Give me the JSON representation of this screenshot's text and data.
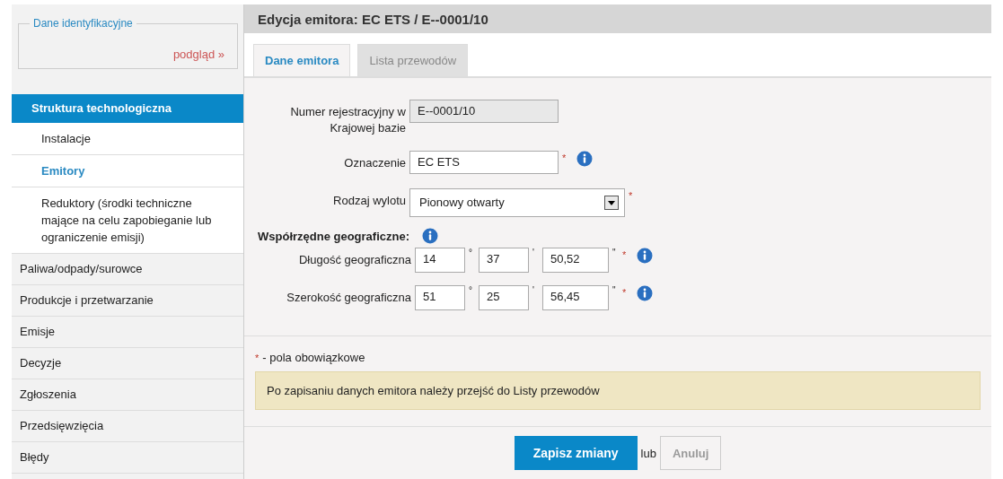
{
  "sidebar": {
    "id_panel": {
      "legend": "Dane identyfikacyjne",
      "link": "podgląd »"
    },
    "items": [
      {
        "label": "Struktura technologiczna",
        "selected": true,
        "children": [
          {
            "label": "Instalacje",
            "selected": false
          },
          {
            "label": "Emitory",
            "selected": true
          },
          {
            "label": "Reduktory (środki techniczne mające na celu zapobieganie lub ograniczenie emisji)",
            "selected": false
          }
        ]
      },
      {
        "label": "Paliwa/odpady/surowce",
        "selected": false
      },
      {
        "label": "Produkcje i przetwarzanie",
        "selected": false
      },
      {
        "label": "Emisje",
        "selected": false
      },
      {
        "label": "Decyzje",
        "selected": false
      },
      {
        "label": "Zgłoszenia",
        "selected": false
      },
      {
        "label": "Przedsięwzięcia",
        "selected": false
      },
      {
        "label": "Błędy",
        "selected": false
      }
    ]
  },
  "header": {
    "title": "Edycja emitora: EC ETS / E--0001/10"
  },
  "tabs": [
    {
      "label": "Dane emitora",
      "selected": true
    },
    {
      "label": "Lista przewodów",
      "selected": false
    }
  ],
  "form": {
    "fields": [
      {
        "kind": "readonly",
        "label": "Numer rejestracyjny w Krajowej bazie",
        "value": "E--0001/10"
      },
      {
        "kind": "text",
        "label": "Oznaczenie",
        "value": "EC ETS",
        "required_mark": "*",
        "info": true
      },
      {
        "kind": "select",
        "label": "Rodzaj wylotu",
        "value": "Pionowy otwarty",
        "required_mark": "*"
      }
    ],
    "coords": {
      "title": "Współrzędne geograficzne:",
      "info": true,
      "rows": [
        {
          "label": "Długość geograficzna",
          "degrees": "14",
          "deg_sign": "°",
          "minutes": "37",
          "min_sign": "'",
          "seconds": "50,52",
          "sec_sign": "\"",
          "required_mark": "*",
          "info": true
        },
        {
          "label": "Szerokość geograficzna",
          "degrees": "51",
          "deg_sign": "°",
          "minutes": "25",
          "min_sign": "'",
          "seconds": "56,45",
          "sec_sign": "\"",
          "required_mark": "*",
          "info": true
        }
      ]
    }
  },
  "legend": {
    "mark": "*",
    "text": "- pola obowiązkowe"
  },
  "notice": "Po zapisaniu danych emitora należy przejść do Listy przewodów",
  "actions": {
    "save": "Zapisz zmiany",
    "or": "lub",
    "cancel": "Anuluj"
  }
}
